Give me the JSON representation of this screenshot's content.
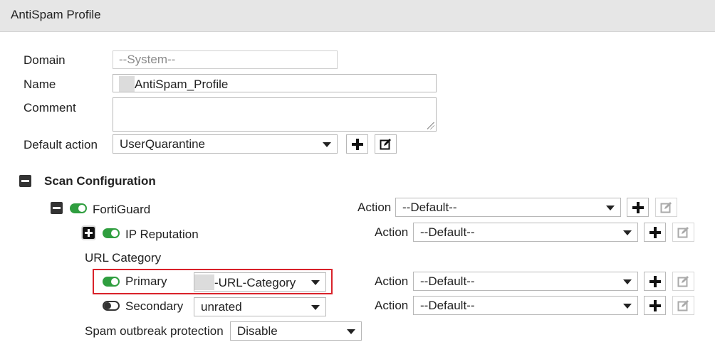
{
  "header": {
    "title": "AntiSpam Profile"
  },
  "form": {
    "domain_label": "Domain",
    "domain_value": "--System--",
    "name_label": "Name",
    "name_value": "AntiSpam_Profile",
    "comment_label": "Comment",
    "comment_value": "",
    "default_action_label": "Default action",
    "default_action_value": "UserQuarantine"
  },
  "scan": {
    "section_title": "Scan Configuration",
    "action_label": "Action",
    "fortiguard": {
      "label": "FortiGuard",
      "enabled": true,
      "action": "--Default--"
    },
    "ip_reputation": {
      "label": "IP Reputation",
      "enabled": true,
      "action": "--Default--"
    },
    "url_category_label": "URL Category",
    "primary": {
      "label": "Primary",
      "enabled": true,
      "value": "-URL-Category",
      "action": "--Default--"
    },
    "secondary": {
      "label": "Secondary",
      "enabled": false,
      "value": "unrated",
      "action": "--Default--"
    },
    "outbreak": {
      "label": "Spam outbreak protection",
      "value": "Disable"
    }
  },
  "colors": {
    "toggle_on": "#2f9e3f",
    "highlight": "#d9222a",
    "header_bg": "#e6e6e6"
  },
  "icons": {
    "add": "plus-icon",
    "edit": "edit-icon",
    "collapse": "collapse-icon",
    "expand": "expand-icon"
  }
}
